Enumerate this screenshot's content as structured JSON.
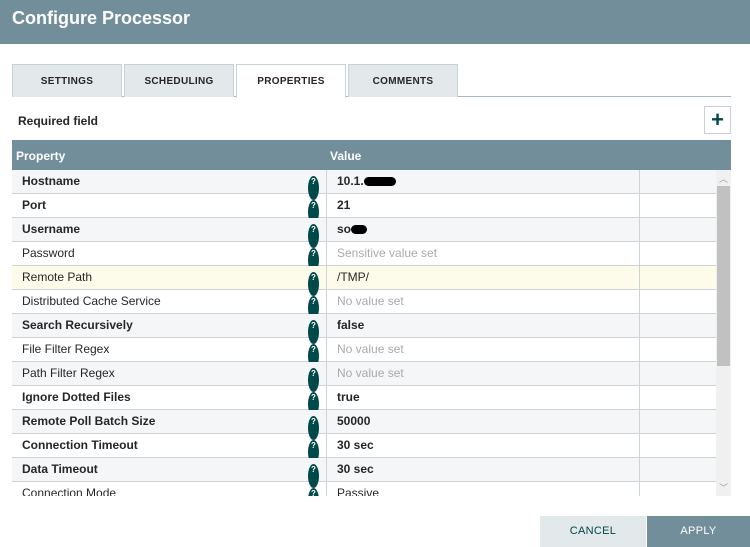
{
  "title": "Configure Processor",
  "tabs": [
    "SETTINGS",
    "SCHEDULING",
    "PROPERTIES",
    "COMMENTS"
  ],
  "required_label": "Required field",
  "add_label": "+",
  "columns": {
    "property": "Property",
    "value": "Value"
  },
  "rows": [
    {
      "name": "Hostname",
      "value": "10.1.",
      "bold": true,
      "redacted": true
    },
    {
      "name": "Port",
      "value": "21",
      "bold": true
    },
    {
      "name": "Username",
      "value": "so",
      "bold": true,
      "redacted": true
    },
    {
      "name": "Password",
      "value": "Sensitive value set",
      "muted": true
    },
    {
      "name": "Remote Path",
      "value": "/TMP/",
      "highlight": true
    },
    {
      "name": "Distributed Cache Service",
      "value": "No value set",
      "muted": true
    },
    {
      "name": "Search Recursively",
      "value": "false",
      "bold": true
    },
    {
      "name": "File Filter Regex",
      "value": "No value set",
      "muted": true
    },
    {
      "name": "Path Filter Regex",
      "value": "No value set",
      "muted": true
    },
    {
      "name": "Ignore Dotted Files",
      "value": "true",
      "bold": true
    },
    {
      "name": "Remote Poll Batch Size",
      "value": "50000",
      "bold": true
    },
    {
      "name": "Connection Timeout",
      "value": "30 sec",
      "bold": true
    },
    {
      "name": "Data Timeout",
      "value": "30 sec",
      "bold": true
    },
    {
      "name": "Connection Mode",
      "value": "Passive"
    }
  ],
  "help_glyph": "?",
  "buttons": {
    "cancel": "CANCEL",
    "apply": "APPLY"
  }
}
